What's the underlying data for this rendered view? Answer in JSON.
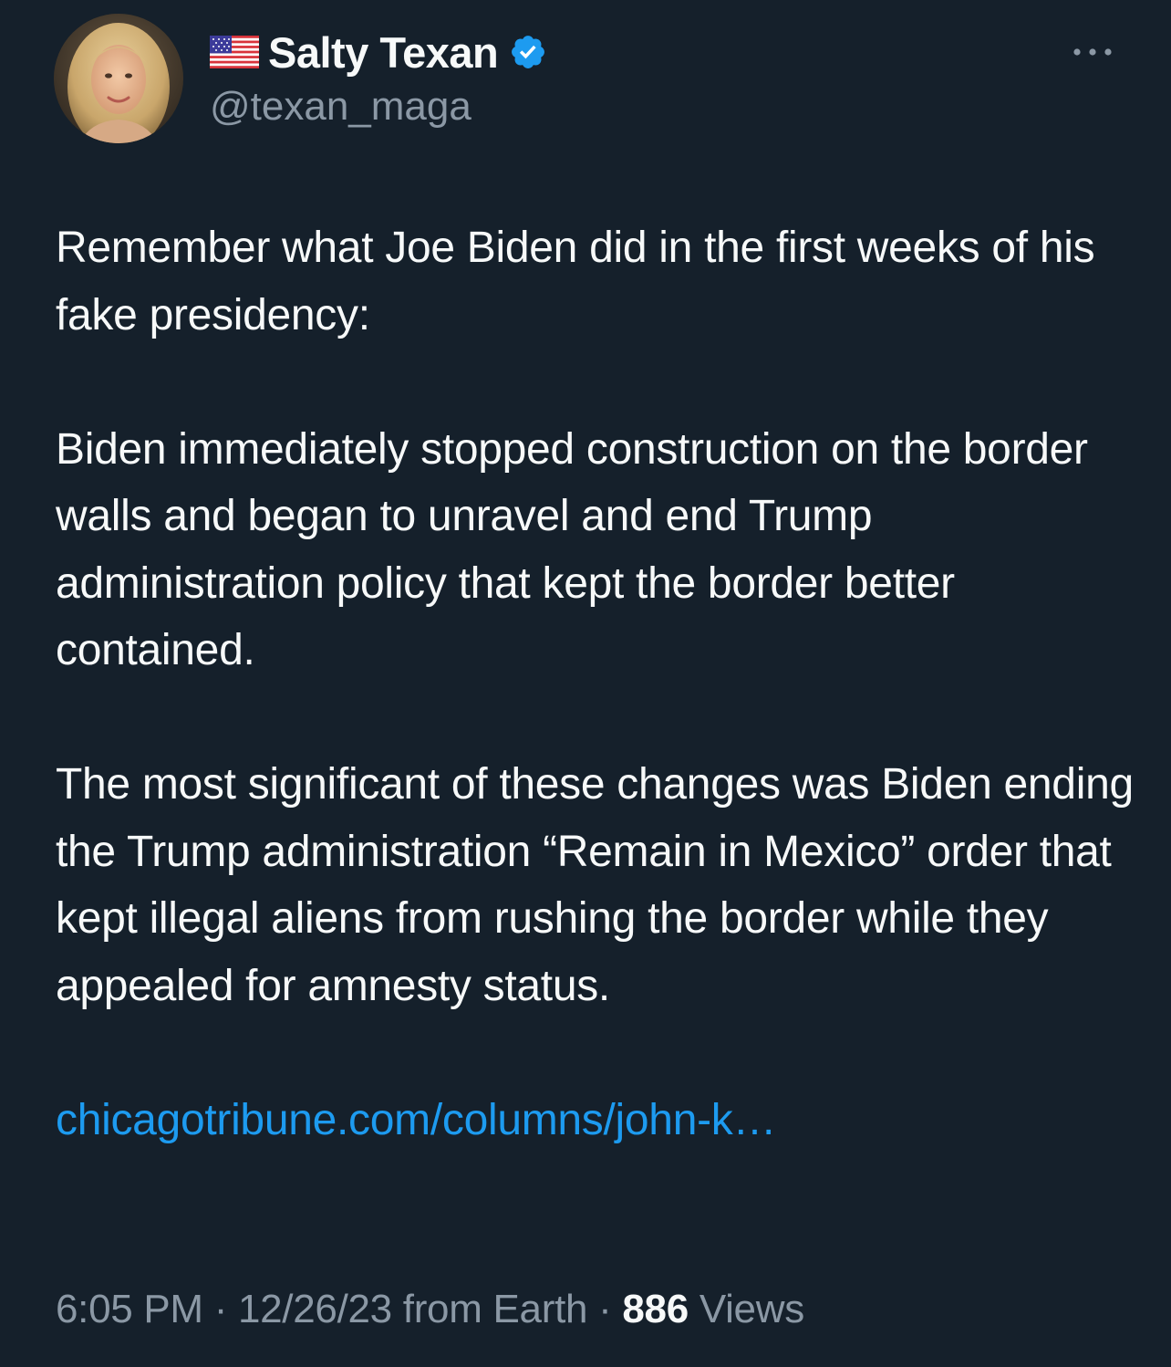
{
  "author": {
    "display_name": "Salty Texan",
    "handle": "@texan_maga",
    "verified": true,
    "flag_icon": "us-flag-icon",
    "avatar_icon": "profile-photo"
  },
  "tweet": {
    "paragraphs": [
      "Remember what Joe Biden did in the first weeks of his fake presidency:",
      "Biden immediately stopped construction on the border walls and began to unravel and end Trump administration policy that kept the border better contained.",
      "The most significant of these changes was Biden ending the Trump administration “Remain in Mexico” order that kept illegal aliens from rushing the border while they appealed for amnesty status."
    ],
    "link_text": "chicagotribune.com/columns/john-k…"
  },
  "meta": {
    "time": "6:05 PM",
    "sep1": " · ",
    "date": "12/26/23",
    "source": " from Earth",
    "sep2": " · ",
    "views_count": "886",
    "views_label": " Views"
  },
  "colors": {
    "background": "#15202b",
    "text_primary": "#f7f9f9",
    "text_secondary": "#8b98a5",
    "accent": "#1d9bf0"
  }
}
